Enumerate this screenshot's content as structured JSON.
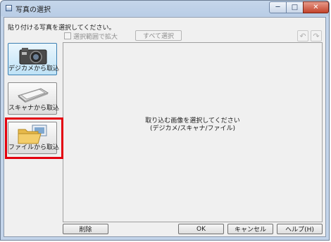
{
  "window": {
    "title": "写真の選択",
    "controls": {
      "minimize": "─",
      "maximize": "□",
      "close": "✕"
    }
  },
  "instruction": "貼り付ける写真を選択してください。",
  "toolbar": {
    "expand_checkbox_label": "選択範囲で拡大",
    "expand_checked": false,
    "select_all_label": "すべて選択",
    "rotate_left_glyph": "↶",
    "rotate_right_glyph": "↷"
  },
  "sources": [
    {
      "label": "デジカメから取込",
      "icon": "camera-icon",
      "selected": true
    },
    {
      "label": "スキャナから取込",
      "icon": "scanner-icon",
      "selected": false
    },
    {
      "label": "ファイルから取込",
      "icon": "folder-icon",
      "selected": false
    }
  ],
  "preview_message": {
    "line1": "取り込む画像を選択してください",
    "line2": "(デジカメ/スキャナ/ファイル)"
  },
  "footer": {
    "delete_label": "削除",
    "ok_label": "OK",
    "cancel_label": "キャンセル",
    "help_label": "ヘルプ(H)"
  },
  "colors": {
    "highlight": "#e3000f",
    "title_bar": "#b9cde6"
  }
}
